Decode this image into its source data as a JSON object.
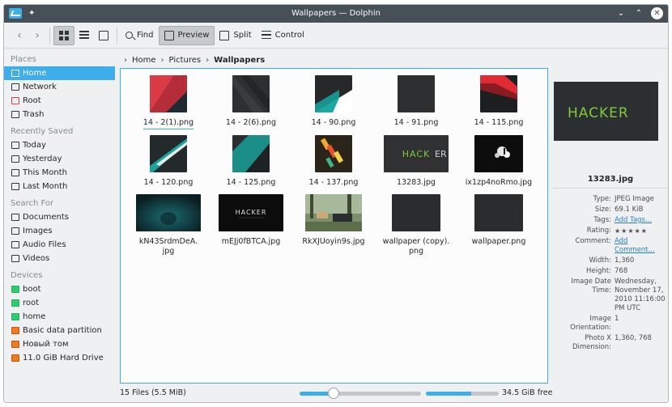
{
  "window": {
    "title": "Wallpapers — Dolphin"
  },
  "toolbar": {
    "find": "Find",
    "preview": "Preview",
    "split": "Split",
    "control": "Control"
  },
  "sidebar": {
    "places_title": "Places",
    "places": [
      "Home",
      "Network",
      "Root",
      "Trash"
    ],
    "recent_title": "Recently Saved",
    "recent": [
      "Today",
      "Yesterday",
      "This Month",
      "Last Month"
    ],
    "search_title": "Search For",
    "search": [
      "Documents",
      "Images",
      "Audio Files",
      "Videos"
    ],
    "devices_title": "Devices",
    "devices": [
      "boot",
      "root",
      "home",
      "Basic data partition",
      "Новый том",
      "11.0 GiB Hard Drive"
    ]
  },
  "breadcrumb": [
    "Home",
    "Pictures",
    "Wallpapers"
  ],
  "files": [
    {
      "name": "14 - 2(1).png",
      "thumb": "red-angle"
    },
    {
      "name": "14 - 2(6).png",
      "thumb": "dark-angle"
    },
    {
      "name": "14 - 90.png",
      "thumb": "teal-white"
    },
    {
      "name": "14 - 91.png",
      "thumb": "dark-texture"
    },
    {
      "name": "14 - 115.png",
      "thumb": "red-stripe"
    },
    {
      "name": "14 - 120.png",
      "thumb": "teal-blade"
    },
    {
      "name": "14 - 125.png",
      "thumb": "teal-dark"
    },
    {
      "name": "14 - 137.png",
      "thumb": "colorful"
    },
    {
      "name": "13283.jpg",
      "thumb": "hacker"
    },
    {
      "name": "ix1zp4noRmo.jpg",
      "thumb": "splash"
    },
    {
      "name": "kN43SrdmDeA.jpg",
      "name_line1": "kN43SrdmDeA.",
      "name_line2": "jpg",
      "thumb": "dark-teal-wide"
    },
    {
      "name": "mEJj0fBTCA.jpg",
      "thumb": "hacker-wide"
    },
    {
      "name": "RkXJUoyin9s.jpg",
      "thumb": "photo"
    },
    {
      "name": "wallpaper (copy).png",
      "name_line1": "wallpaper (copy).",
      "name_line2": "png",
      "thumb": "dark-texture"
    },
    {
      "name": "wallpaper.png",
      "thumb": "dark-texture"
    }
  ],
  "preview": {
    "filename": "13283.jpg",
    "logo_text": "HACKER"
  },
  "metadata": [
    {
      "key": "Type:",
      "value": "JPEG Image"
    },
    {
      "key": "Size:",
      "value": "69.1 KiB"
    },
    {
      "key": "Tags:",
      "value": "Add Tags...",
      "link": true
    },
    {
      "key": "Rating:",
      "value": "★★★★★"
    },
    {
      "key": "Comment:",
      "value": "Add Comment...",
      "link": true
    },
    {
      "key": "Width:",
      "value": "1,360"
    },
    {
      "key": "Height:",
      "value": "768"
    },
    {
      "key": "Image Date Time:",
      "value": "Wednesday, November 17, 2010 11:16:00 PM UTC"
    },
    {
      "key": "Image Orientation:",
      "value": "1"
    },
    {
      "key": "Photo X Dimension:",
      "value": "1,360, 768"
    }
  ],
  "status": {
    "files_text": "15 Files (5.5 MiB)",
    "zoom_fraction": 0.28,
    "space_used_fraction": 0.62,
    "free_text": "34.5 GiB free"
  },
  "colors": {
    "accent": "#3daee9",
    "titlebar": "#475057",
    "hacker_green": "#7ecb3a"
  }
}
